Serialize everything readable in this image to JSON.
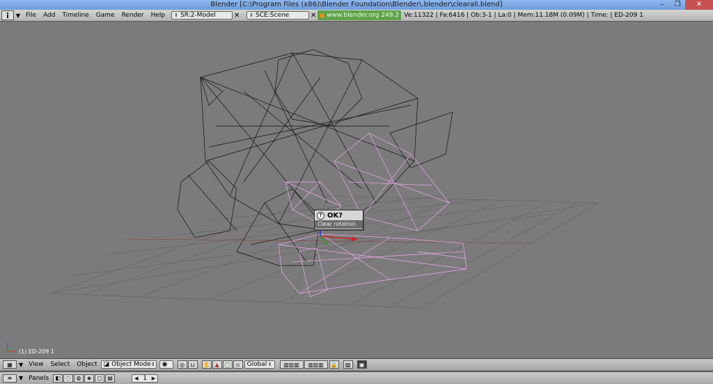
{
  "window": {
    "title": "Blender [C:\\Program Files (x86)\\Blender Foundation\\Blender\\.blender\\clearall.blend]",
    "minimize": "–",
    "maximize": "❐",
    "close": "✕"
  },
  "info": {
    "menus": [
      "File",
      "Add",
      "Timeline",
      "Game",
      "Render",
      "Help"
    ],
    "screen_field": "SR:2-Model",
    "scene_field": "SCE:Scene",
    "site": "www.blender.org 249.2",
    "stats": "Ve:11322 | Fa:6416 | Ob:3-1 | La:0  | Mem:11.18M (0.09M)  | Time: | ED-209 1"
  },
  "viewport": {
    "object_label": "(1) ED-209 1"
  },
  "popup": {
    "title": "OK?",
    "item": "Clear rotation"
  },
  "view_header": {
    "menus": [
      "View",
      "Select",
      "Object"
    ],
    "mode": "Object Mode",
    "orientation": "Global"
  },
  "panel_header": {
    "label": "Panels",
    "frame": "1"
  },
  "colors": {
    "wire_black": "#111111",
    "wire_selected": "#f0a8f0",
    "grid": "#5f5f5f",
    "site_bg": "#5ea34a"
  }
}
